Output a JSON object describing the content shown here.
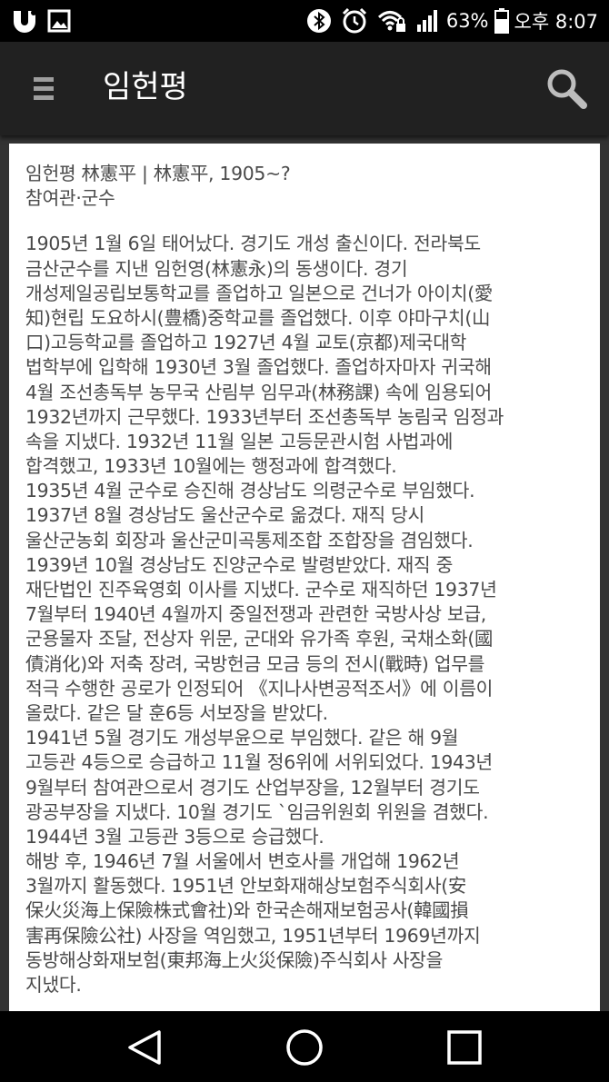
{
  "status_bar": {
    "left_icons": [
      "u-plus-icon",
      "gallery-icon"
    ],
    "right_icons": [
      "bluetooth-icon",
      "alarm-icon",
      "wifi-lock-icon",
      "signal-icon"
    ],
    "battery_percent": "63%",
    "time": "오후 8:07"
  },
  "app_bar": {
    "title": "임헌평",
    "menu_icon": "hamburger-icon",
    "search_icon": "search-icon"
  },
  "article": {
    "header_lines": [
      "임헌평 林憲平 | 林憲平, 1905~?",
      "참여관·군수"
    ],
    "body_lines": [
      "1905년 1월 6일 태어났다. 경기도 개성 출신이다. 전라북도",
      "금산군수를 지낸 임헌영(林憲永)의 동생이다. 경기",
      "개성제일공립보통학교를 졸업하고 일본으로 건너가 아이치(愛",
      "知)현립 도요하시(豊橋)중학교를 졸업했다. 이후 야마구치(山",
      "口)고등학교를 졸업하고 1927년 4월 교토(京都)제국대학",
      "법학부에 입학해 1930년 3월 졸업했다. 졸업하자마자 귀국해",
      "4월 조선총독부 농무국 산림부 임무과(林務課) 속에 임용되어",
      "1932년까지 근무했다. 1933년부터 조선총독부 농림국 임정과",
      "속을 지냈다. 1932년 11월 일본 고등문관시험 사법과에",
      "합격했고, 1933년 10월에는 행정과에 합격했다.",
      "1935년 4월 군수로 승진해 경상남도 의령군수로 부임했다.",
      "1937년 8월 경상남도 울산군수로 옮겼다. 재직 당시",
      "울산군농회 회장과 울산군미곡통제조합 조합장을 겸임했다.",
      "1939년 10월 경상남도 진양군수로 발령받았다. 재직 중",
      "재단법인 진주육영회 이사를 지냈다. 군수로 재직하던 1937년",
      "7월부터 1940년 4월까지 중일전쟁과 관련한 국방사상 보급,",
      "군용물자 조달, 전상자 위문, 군대와 유가족 후원, 국채소화(國",
      "債消化)와 저축 장려, 국방헌금 모금 등의 전시(戰時) 업무를",
      "적극 수행한 공로가 인정되어 《지나사변공적조서》에 이름이",
      "올랐다. 같은 달 훈6등 서보장을 받았다.",
      "1941년 5월 경기도 개성부윤으로 부임했다. 같은 해 9월",
      "고등관 4등으로 승급하고 11월 정6위에 서위되었다. 1943년",
      "9월부터 참여관으로서 경기도 산업부장을, 12월부터 경기도",
      "광공부장을 지냈다. 10월 경기도 `임금위원회 위원을 겸했다.",
      "1944년 3월 고등관 3등으로 승급했다.",
      "해방 후, 1946년 7월 서울에서 변호사를 개업해 1962년",
      "3월까지 활동했다. 1951년 안보화재해상보험주식회사(安",
      "保火災海上保險株式會社)와 한국손해재보험공사(韓國損",
      "害再保險公社) 사장을 역임했고, 1951년부터 1969년까지",
      "동방해상화재보험(東邦海上火災保險)주식회사 사장을",
      "지냈다."
    ]
  },
  "nav_bar": {
    "back_icon": "back-triangle-icon",
    "home_icon": "home-circle-icon",
    "recent_icon": "recent-square-icon"
  },
  "colors": {
    "status_bar_bg": "#000000",
    "app_bar_bg": "#212121",
    "page_bg": "#333333",
    "card_bg": "#ffffff",
    "text": "#4a4a4a"
  }
}
